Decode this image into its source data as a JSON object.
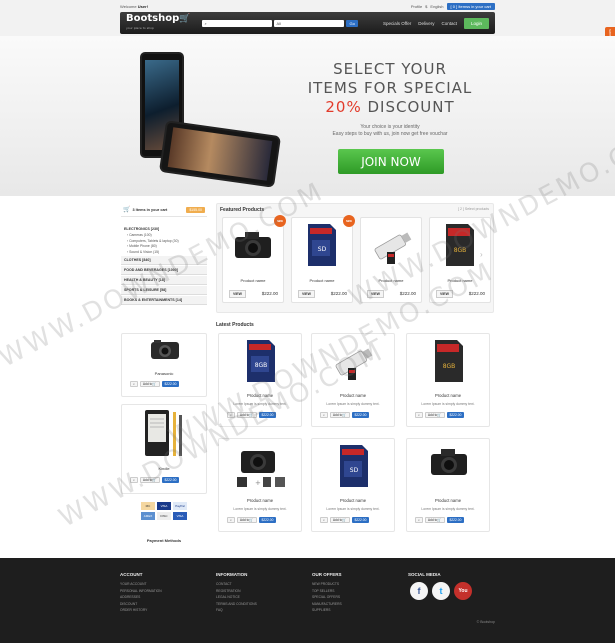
{
  "topbar": {
    "welcome_prefix": "Welcome",
    "welcome_user": "User!",
    "prefs": "Profile",
    "lang": "$",
    "currency": "English",
    "cart_summary": "[ 0 ] Itemss in your cart"
  },
  "nav": {
    "logo_text": "Bootshop",
    "logo_tagline": "your place to shop",
    "search_placeholder": "",
    "category_select": "All",
    "go_label": "Go",
    "links": [
      "Specials Offer",
      "Delivery",
      "Contact"
    ],
    "login_label": "Login"
  },
  "sidetab": {
    "label": "SWITCH THEME"
  },
  "hero": {
    "line1": "SELECT YOUR",
    "line2": "ITEMS FOR SPECIAL",
    "line3_pct": "20%",
    "line3_rest": "DISCOUNT",
    "sub1": "Your choice is your identity",
    "sub2": "Easy steps to buy with us, join now get free vouchar",
    "join_label": "JOIN NOW"
  },
  "sidebar": {
    "cart_text": "3 Items in your cart",
    "cart_btn": "$155.00",
    "cats": [
      {
        "label": "ELECTRONICS [230]",
        "open": true,
        "subs": [
          "Cameras (100)",
          "Computers, Tablets & laptop (30)",
          "Mobile Phone (80)",
          "Sound & Vision (15)"
        ]
      },
      {
        "label": "CLOTHES [840]"
      },
      {
        "label": "FOOD AND BEVERAGES [1000]"
      },
      {
        "label": "HEALTH & BEAUTY [18]"
      },
      {
        "label": "SPORTS & LEISURE [58]"
      },
      {
        "label": "BOOKS & ENTERTAINMENTS [14]"
      }
    ],
    "products": [
      {
        "name": "Panasonic",
        "add": "Add to",
        "price": "$222.00"
      },
      {
        "name": "Kindle",
        "add": "Add to",
        "price": "$222.00"
      }
    ],
    "payment_label": "Payment Methods",
    "cards": [
      "MC",
      "VISA",
      "PayPal",
      "AMEX",
      "DISC",
      "VISA"
    ]
  },
  "featured": {
    "heading": "Featured Products",
    "count": "[ 2 ] Select products",
    "new_tag": "NEW",
    "items": [
      {
        "name": "Product name",
        "view": "VIEW",
        "price": "$222.00"
      },
      {
        "name": "Product name",
        "view": "VIEW",
        "price": "$222.00"
      },
      {
        "name": "Product name",
        "view": "VIEW",
        "price": "$222.00"
      },
      {
        "name": "Product name",
        "view": "VIEW",
        "price": "$222.00"
      }
    ]
  },
  "latest": {
    "heading": "Latest Products",
    "items": [
      {
        "name": "Product name",
        "desc": "Lorem Ipsum is simply dummy text.",
        "add": "Add to",
        "price": "$222.00"
      },
      {
        "name": "Product name",
        "desc": "Lorem Ipsum is simply dummy text.",
        "add": "Add to",
        "price": "$222.00"
      },
      {
        "name": "Product name",
        "desc": "Lorem Ipsum is simply dummy text.",
        "add": "Add to",
        "price": "$222.00"
      },
      {
        "name": "Product name",
        "desc": "Lorem Ipsum is simply dummy text.",
        "add": "Add to",
        "price": "$222.00"
      },
      {
        "name": "Product name",
        "desc": "Lorem Ipsum is simply dummy text.",
        "add": "Add to",
        "price": "$222.00"
      },
      {
        "name": "Product name",
        "desc": "Lorem Ipsum is simply dummy text.",
        "add": "Add to",
        "price": "$222.00"
      }
    ]
  },
  "footer": {
    "cols": [
      {
        "heading": "ACCOUNT",
        "items": [
          "YOUR ACCOUNT",
          "PERSONAL INFORMATION",
          "ADDRESSES",
          "DISCOUNT",
          "ORDER HISTORY"
        ]
      },
      {
        "heading": "INFORMATION",
        "items": [
          "CONTACT",
          "REGISTRATION",
          "LEGAL NOTICE",
          "TERMS AND CONDITIONS",
          "FAQ"
        ]
      },
      {
        "heading": "OUR OFFERS",
        "items": [
          "NEW PRODUCTS",
          "TOP SELLERS",
          "SPECIAL OFFERS",
          "MANUFACTURERS",
          "SUPPLIERS"
        ]
      }
    ],
    "social_heading": "SOCIAL MEDIA",
    "social": [
      "f",
      "t",
      "You"
    ],
    "credit": "© Bootshop"
  },
  "watermark": "WWW.DOWNDEMO.COM"
}
